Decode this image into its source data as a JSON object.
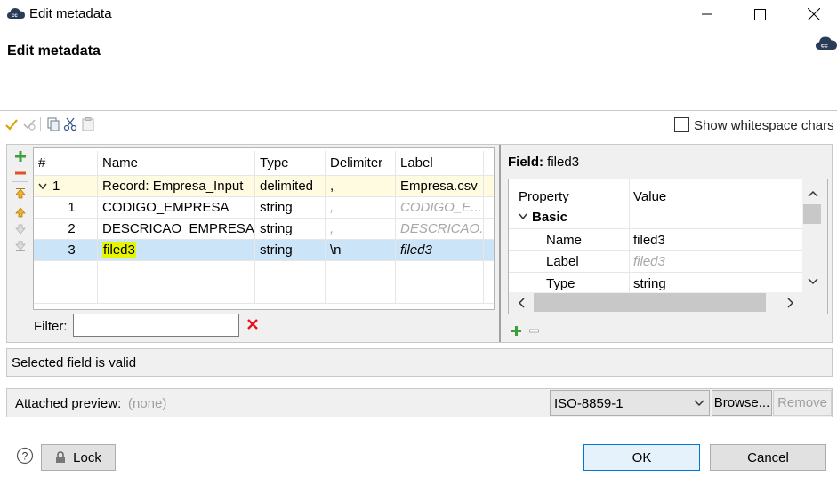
{
  "window": {
    "title": "Edit metadata"
  },
  "header": {
    "title": "Edit metadata"
  },
  "toolbar": {
    "show_whitespace_label": "Show whitespace chars",
    "show_whitespace_checked": false
  },
  "fields_table": {
    "columns": [
      "#",
      "Name",
      "Type",
      "Delimiter",
      "Label"
    ],
    "record": {
      "num": "1",
      "name": "Record: Empresa_Input",
      "type": "delimited",
      "delimiter": ",",
      "label": "Empresa.csv"
    },
    "rows": [
      {
        "num": "1",
        "name": "CODIGO_EMPRESA",
        "type": "string",
        "delimiter": ",",
        "label": "CODIGO_E..."
      },
      {
        "num": "2",
        "name": "DESCRICAO_EMPRESA",
        "type": "string",
        "delimiter": ",",
        "label": "DESCRICAO..."
      },
      {
        "num": "3",
        "name": "filed3",
        "type": "string",
        "delimiter": "\\n",
        "label": "filed3"
      }
    ],
    "selected_row": 3
  },
  "filter": {
    "label": "Filter:",
    "value": ""
  },
  "field_details": {
    "title_prefix": "Field:",
    "title_value": "filed3",
    "columns": [
      "Property",
      "Value"
    ],
    "group": "Basic",
    "properties": [
      {
        "name": "Name",
        "value": "filed3"
      },
      {
        "name": "Label",
        "value": "filed3"
      },
      {
        "name": "Type",
        "value": "string"
      }
    ]
  },
  "status": {
    "text": "Selected field is valid"
  },
  "preview": {
    "label": "Attached preview:",
    "value": "(none)",
    "encoding": "ISO-8859-1",
    "browse_label": "Browse...",
    "remove_label": "Remove"
  },
  "footer": {
    "lock_label": "Lock",
    "ok_label": "OK",
    "cancel_label": "Cancel"
  },
  "colors": {
    "selection": "#cce4f7",
    "record_row": "#fffbe0",
    "highlight": "#e6f500",
    "ok_border": "#0078d7",
    "error": "#e81123"
  }
}
